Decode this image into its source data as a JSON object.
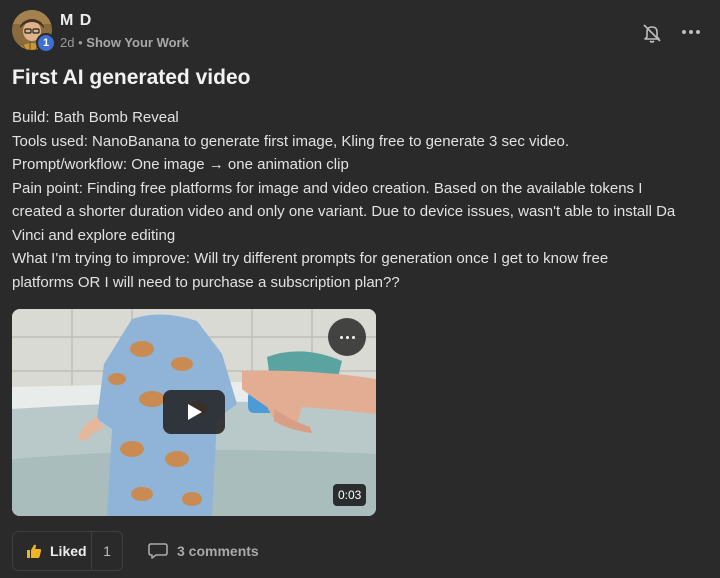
{
  "author": {
    "name": "M D",
    "level": "1",
    "time": "2d",
    "separator": "•",
    "category": "Show Your Work",
    "avatar_icon": "avatar-illustration"
  },
  "header_actions": {
    "notifications_icon": "bell-off-icon",
    "more_icon": "more-horizontal-icon"
  },
  "post": {
    "title": "First AI generated video",
    "body_lines": [
      "Build: Bath Bomb Reveal",
      "Tools used: NanoBanana to generate first image, Kling free to generate 3 sec video.",
      "Prompt/workflow: One image → one animation clip",
      "Pain point: Finding free platforms for image and video creation. Based on the available tokens I",
      "created a shorter duration video and only one variant. Due to device issues, wasn't able to install Da",
      "Vinci and explore editing",
      "What I'm trying to improve: Will try different prompts for generation once I get to know free",
      "platforms OR I will need to purchase a subscription plan??"
    ]
  },
  "video": {
    "duration": "0:03",
    "play_icon": "play-icon",
    "menu_icon": "more-horizontal-icon"
  },
  "footer": {
    "like_label": "Liked",
    "like_count": "1",
    "like_icon": "thumbs-up-icon",
    "comments_label": "3 comments",
    "comments_icon": "comment-icon"
  },
  "colors": {
    "background": "#2a2a2a",
    "level_badge": "#3f6fd0",
    "like_icon": "#f0b429"
  }
}
